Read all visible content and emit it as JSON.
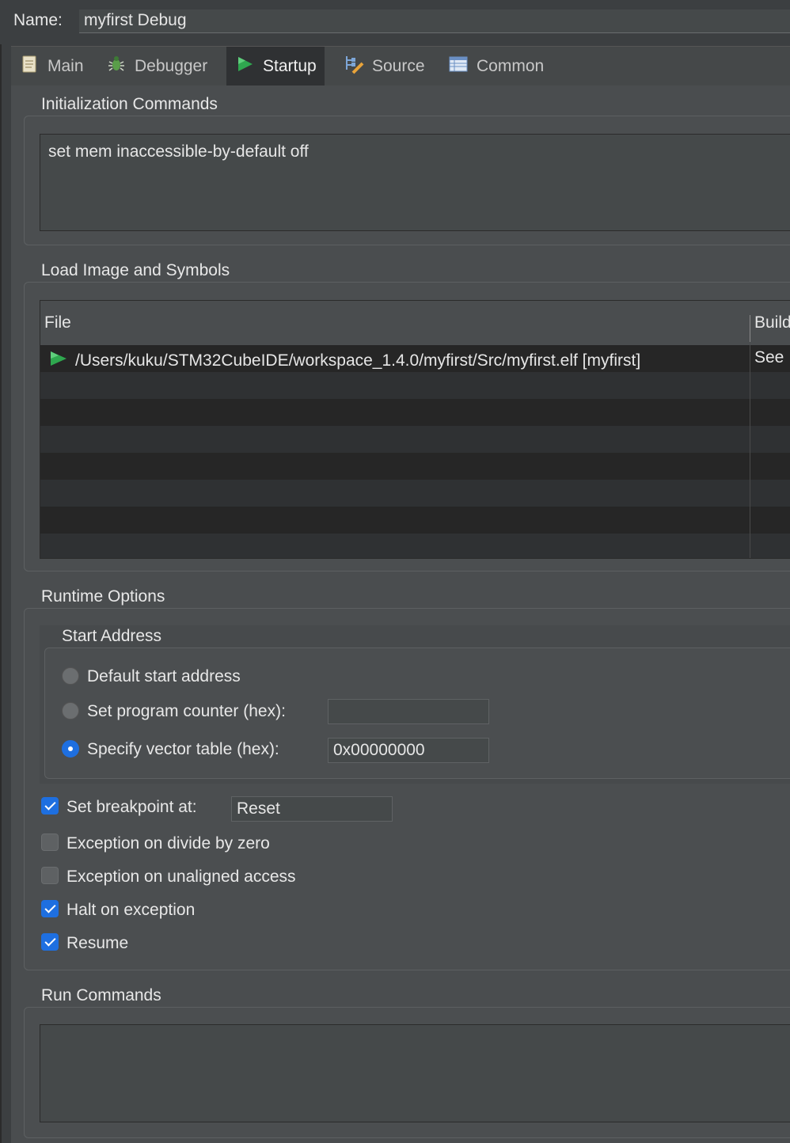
{
  "name": {
    "label": "Name:",
    "value": "myfirst Debug"
  },
  "tabs": [
    {
      "label": "Main",
      "icon": "document-icon",
      "active": false
    },
    {
      "label": "Debugger",
      "icon": "bug-icon",
      "active": false
    },
    {
      "label": "Startup",
      "icon": "play-icon",
      "active": true
    },
    {
      "label": "Source",
      "icon": "source-lookup-icon",
      "active": false
    },
    {
      "label": "Common",
      "icon": "table-icon",
      "active": false
    }
  ],
  "init": {
    "title": "Initialization Commands",
    "text": "set mem inaccessible-by-default off"
  },
  "load": {
    "title": "Load Image and Symbols",
    "columns": {
      "file": "File",
      "build": "Build"
    },
    "rows": [
      {
        "file": "/Users/kuku/STM32CubeIDE/workspace_1.4.0/myfirst/Src/myfirst.elf [myfirst]",
        "build": "See",
        "icon": "play-icon"
      }
    ]
  },
  "runtime": {
    "title": "Runtime Options",
    "start_address": {
      "title": "Start Address",
      "options": [
        {
          "label": "Default start address",
          "checked": false
        },
        {
          "label": "Set program counter (hex):",
          "checked": false,
          "value": ""
        },
        {
          "label": "Specify vector table (hex):",
          "checked": true,
          "value": "0x00000000"
        }
      ]
    },
    "checks": [
      {
        "label": "Set breakpoint at:",
        "checked": true,
        "value": "Reset"
      },
      {
        "label": "Exception on divide by zero",
        "checked": false
      },
      {
        "label": "Exception on unaligned access",
        "checked": false
      },
      {
        "label": "Halt on exception",
        "checked": true
      },
      {
        "label": "Resume",
        "checked": true
      }
    ]
  },
  "run": {
    "title": "Run Commands",
    "text": ""
  },
  "colors": {
    "accent": "#1e6fe0",
    "play_green": "#2fa84f",
    "background": "#3c3f41"
  }
}
